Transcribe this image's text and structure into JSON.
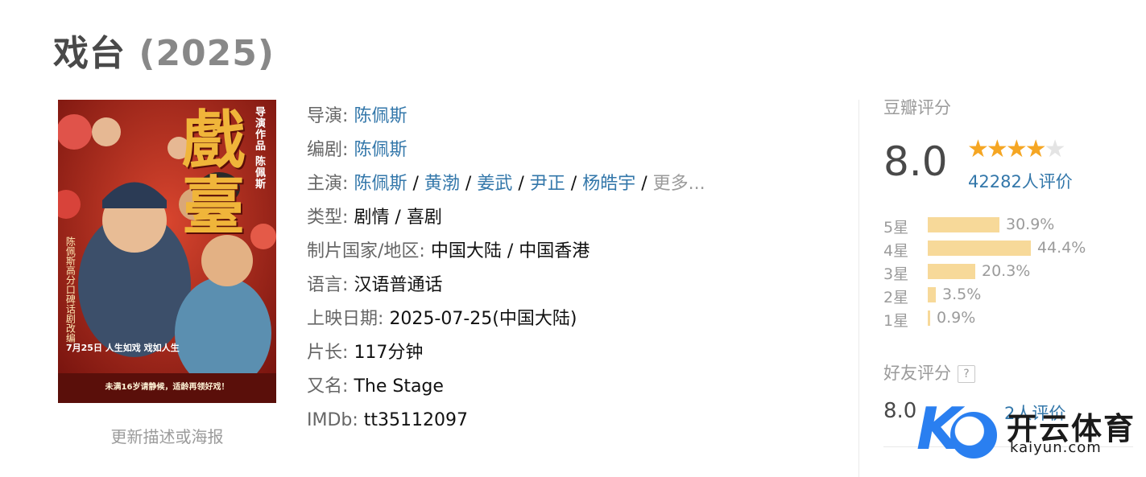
{
  "title": {
    "name": "戏台",
    "year": "(2025)"
  },
  "poster": {
    "big_chars": "戲臺",
    "director_credit": "导演作品 陈佩斯",
    "left_text": "陈佩斯高分口碑话剧改编",
    "release_text": "7月25日 人生如戏 戏如人生",
    "bottom_text": "未满16岁请静候，适龄再领好戏！"
  },
  "update_link": "更新描述或海报",
  "info": {
    "director_label": "导演",
    "director": "陈佩斯",
    "writer_label": "编剧",
    "writer": "陈佩斯",
    "cast_label": "主演",
    "cast": [
      "陈佩斯",
      "黄渤",
      "姜武",
      "尹正",
      "杨皓宇"
    ],
    "cast_more": "更多...",
    "genre_label": "类型",
    "genre": "剧情 / 喜剧",
    "country_label": "制片国家/地区",
    "country": "中国大陆 / 中国香港",
    "language_label": "语言",
    "language": "汉语普通话",
    "release_label": "上映日期",
    "release": "2025-07-25(中国大陆)",
    "runtime_label": "片长",
    "runtime": "117分钟",
    "aka_label": "又名",
    "aka": "The Stage",
    "imdb_label": "IMDb",
    "imdb": "tt35112097",
    "colon": ":",
    "slash": "/"
  },
  "rating": {
    "title": "豆瓣评分",
    "score": "8.0",
    "stars_filled": 4,
    "stars_total": 5,
    "votes": "42282人评价",
    "distribution": [
      {
        "label": "5星",
        "percent": "30.9%",
        "value": 30.9
      },
      {
        "label": "4星",
        "percent": "44.4%",
        "value": 44.4
      },
      {
        "label": "3星",
        "percent": "20.3%",
        "value": 20.3
      },
      {
        "label": "2星",
        "percent": "3.5%",
        "value": 3.5
      },
      {
        "label": "1星",
        "percent": "0.9%",
        "value": 0.9
      }
    ],
    "friends_title": "好友评分",
    "friends_help": "?",
    "friends_score": "8.0",
    "friends_count": "2人评价"
  },
  "watermark": {
    "cn": "开云体育",
    "en": "kaiyun.com",
    "letter": "K"
  },
  "colors": {
    "link": "#3377aa",
    "bar": "#f7d999",
    "star": "#f5a623",
    "poster_red": "#b42a1f"
  }
}
